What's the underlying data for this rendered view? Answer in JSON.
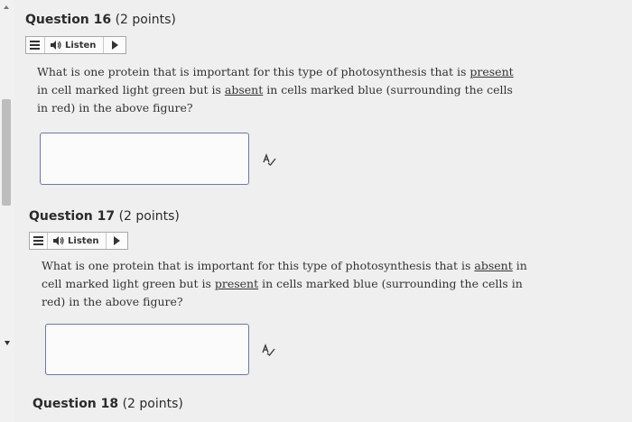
{
  "questions": [
    {
      "title": "Question 16",
      "points": "(2 points)",
      "listen_label": "Listen",
      "text": {
        "p1": "What is one protein that is important for this type of photosynthesis that is ",
        "u1": "present",
        "p2": " in cell marked light green but is ",
        "u2": "absent",
        "p3": " in cells marked blue (surrounding the cells in red) in the above figure?"
      },
      "answer_value": ""
    },
    {
      "title": "Question 17",
      "points": "(2 points)",
      "listen_label": "Listen",
      "text": {
        "p1": "What is one protein that is important for this type of photosynthesis that is ",
        "u1": "absent",
        "p2": " in cell marked light green but is ",
        "u2": "present",
        "p3": " in cells marked blue (surrounding the cells in red) in the above figure?"
      },
      "answer_value": ""
    },
    {
      "title": "Question 18",
      "points": "(2 points)"
    }
  ],
  "icons": {
    "menu": "hamburger-icon",
    "speaker": "speaker-icon",
    "play": "play-icon",
    "spellcheck": "spellcheck-icon"
  }
}
